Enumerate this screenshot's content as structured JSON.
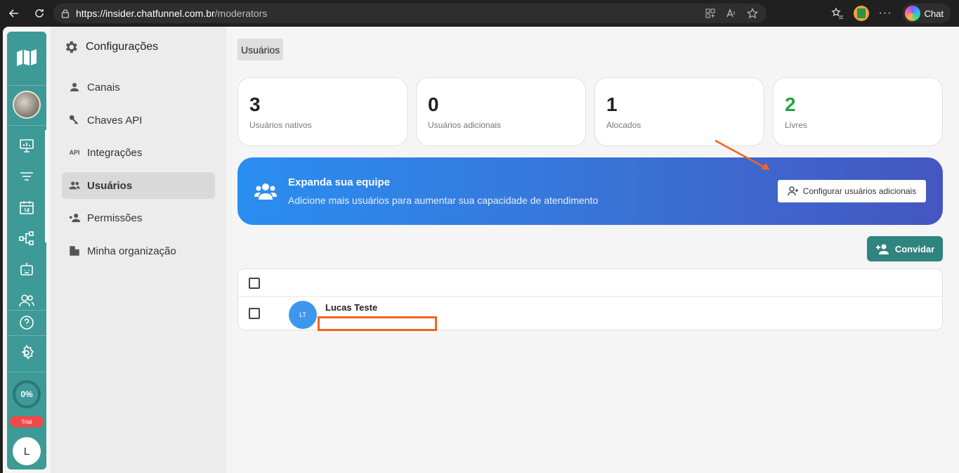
{
  "browser": {
    "url_host": "https://insider.chatfunnel.com.br",
    "url_path": "/moderators",
    "chat_label": "Chat"
  },
  "rail": {
    "progress_label": "0%",
    "trial_label": "Trial",
    "user_initial": "L",
    "icons": [
      "presentation-chart-icon",
      "filter-icon",
      "calendar-icon",
      "flow-icon",
      "bot-icon",
      "users-icon",
      "help-icon",
      "settings-icon"
    ]
  },
  "sidebar": {
    "title": "Configurações",
    "items": [
      {
        "label": "Canais",
        "icon": "person-icon"
      },
      {
        "label": "Chaves API",
        "icon": "key-icon"
      },
      {
        "label": "Integrações",
        "icon": "api-icon",
        "glyph": "API"
      },
      {
        "label": "Usuários",
        "icon": "users-icon",
        "active": true
      },
      {
        "label": "Permissões",
        "icon": "permissions-icon"
      },
      {
        "label": "Minha organização",
        "icon": "building-icon"
      }
    ]
  },
  "main": {
    "tab_label": "Usuários",
    "stats": [
      {
        "value": "3",
        "label": "Usuários nativos"
      },
      {
        "value": "0",
        "label": "Usuários adicionais"
      },
      {
        "value": "1",
        "label": "Alocados"
      },
      {
        "value": "2",
        "label": "Livres"
      }
    ],
    "banner": {
      "title": "Expanda sua equipe",
      "subtitle": "Adicione mais usuários para aumentar sua capacidade de atendimento",
      "button_label": "Configurar usuários adicionais"
    },
    "invite_label": "Convidar",
    "users": [
      {
        "initials": "LT",
        "name": "Lucas Teste"
      }
    ]
  },
  "colors": {
    "rail": "#3d9a96",
    "invite": "#2f847f",
    "accent_green": "#27a243",
    "annotation": "#f3631c"
  }
}
